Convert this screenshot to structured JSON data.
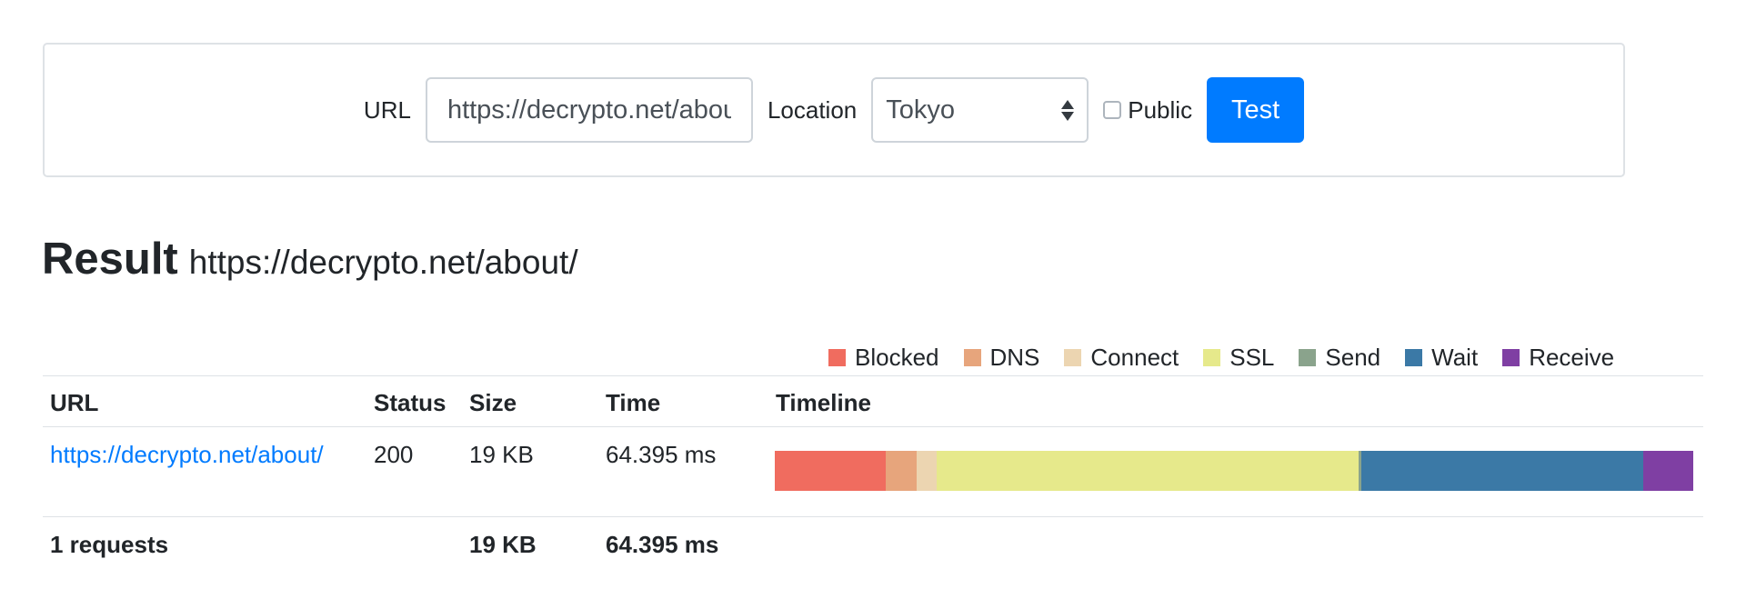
{
  "form": {
    "url_label": "URL",
    "url_value": "https://decrypto.net/about/",
    "location_label": "Location",
    "location_value": "Tokyo",
    "public_label": "Public",
    "public_checked": false,
    "test_button": "Test"
  },
  "result": {
    "heading": "Result",
    "url": "https://decrypto.net/about/"
  },
  "legend": [
    {
      "label": "Blocked",
      "color": "#f06c5f"
    },
    {
      "label": "DNS",
      "color": "#e7a57c"
    },
    {
      "label": "Connect",
      "color": "#ecd5b1"
    },
    {
      "label": "SSL",
      "color": "#e6e98b"
    },
    {
      "label": "Send",
      "color": "#8aa38c"
    },
    {
      "label": "Wait",
      "color": "#3b79a6"
    },
    {
      "label": "Receive",
      "color": "#7f3fa3"
    }
  ],
  "table": {
    "headers": {
      "url": "URL",
      "status": "Status",
      "size": "Size",
      "time": "Time",
      "timeline": "Timeline"
    },
    "rows": [
      {
        "url": "https://decrypto.net/about/",
        "status": "200",
        "size": "19 KB",
        "time": "64.395 ms"
      }
    ],
    "footer": {
      "requests": "1 requests",
      "size": "19 KB",
      "time": "64.395 ms"
    }
  },
  "timeline_fractions": [
    {
      "phase": "Blocked",
      "fraction": 0.121
    },
    {
      "phase": "DNS",
      "fraction": 0.033
    },
    {
      "phase": "Connect",
      "fraction": 0.022
    },
    {
      "phase": "SSL",
      "fraction": 0.46
    },
    {
      "phase": "Send",
      "fraction": 0.003
    },
    {
      "phase": "Wait",
      "fraction": 0.307
    },
    {
      "phase": "Receive",
      "fraction": 0.054
    }
  ]
}
